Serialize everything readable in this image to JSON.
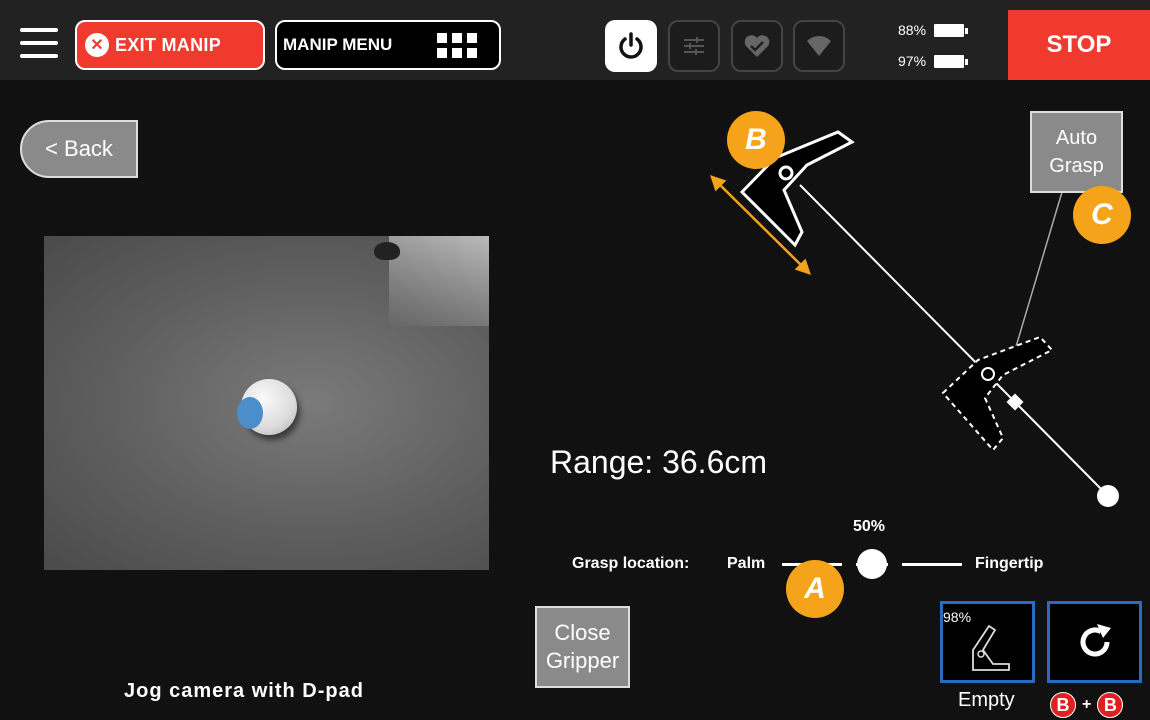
{
  "topbar": {
    "exit_label": "EXIT MANIP",
    "menu_label": "MANIP MENU",
    "battery_1": "88%",
    "battery_2": "97%",
    "stop_label": "STOP"
  },
  "nav": {
    "back_label": "< Back"
  },
  "camera": {
    "hint": "Jog camera with D-pad"
  },
  "range": {
    "text": "Range: 36.6cm"
  },
  "grasp": {
    "label": "Grasp location:",
    "min_label": "Palm",
    "max_label": "Fingertip",
    "value_text": "50%",
    "value": 0.5
  },
  "buttons": {
    "auto_grasp": "Auto Grasp",
    "close_gripper": "Close Gripper"
  },
  "badges": {
    "a": "A",
    "b": "B",
    "c": "C"
  },
  "gripper": {
    "percent": "98%",
    "state": "Empty",
    "combo_key_1": "B",
    "combo_plus": "+",
    "combo_key_2": "B"
  },
  "colors": {
    "accent": "#f5a31a",
    "danger": "#f03a2e",
    "selection": "#2a6ac0"
  },
  "icons": [
    "menu-icon",
    "close-circle-icon",
    "grid-icon",
    "power-icon",
    "sliders-icon",
    "heart-icon",
    "wifi-icon",
    "battery-icon",
    "gripper-icon",
    "refresh-icon"
  ]
}
